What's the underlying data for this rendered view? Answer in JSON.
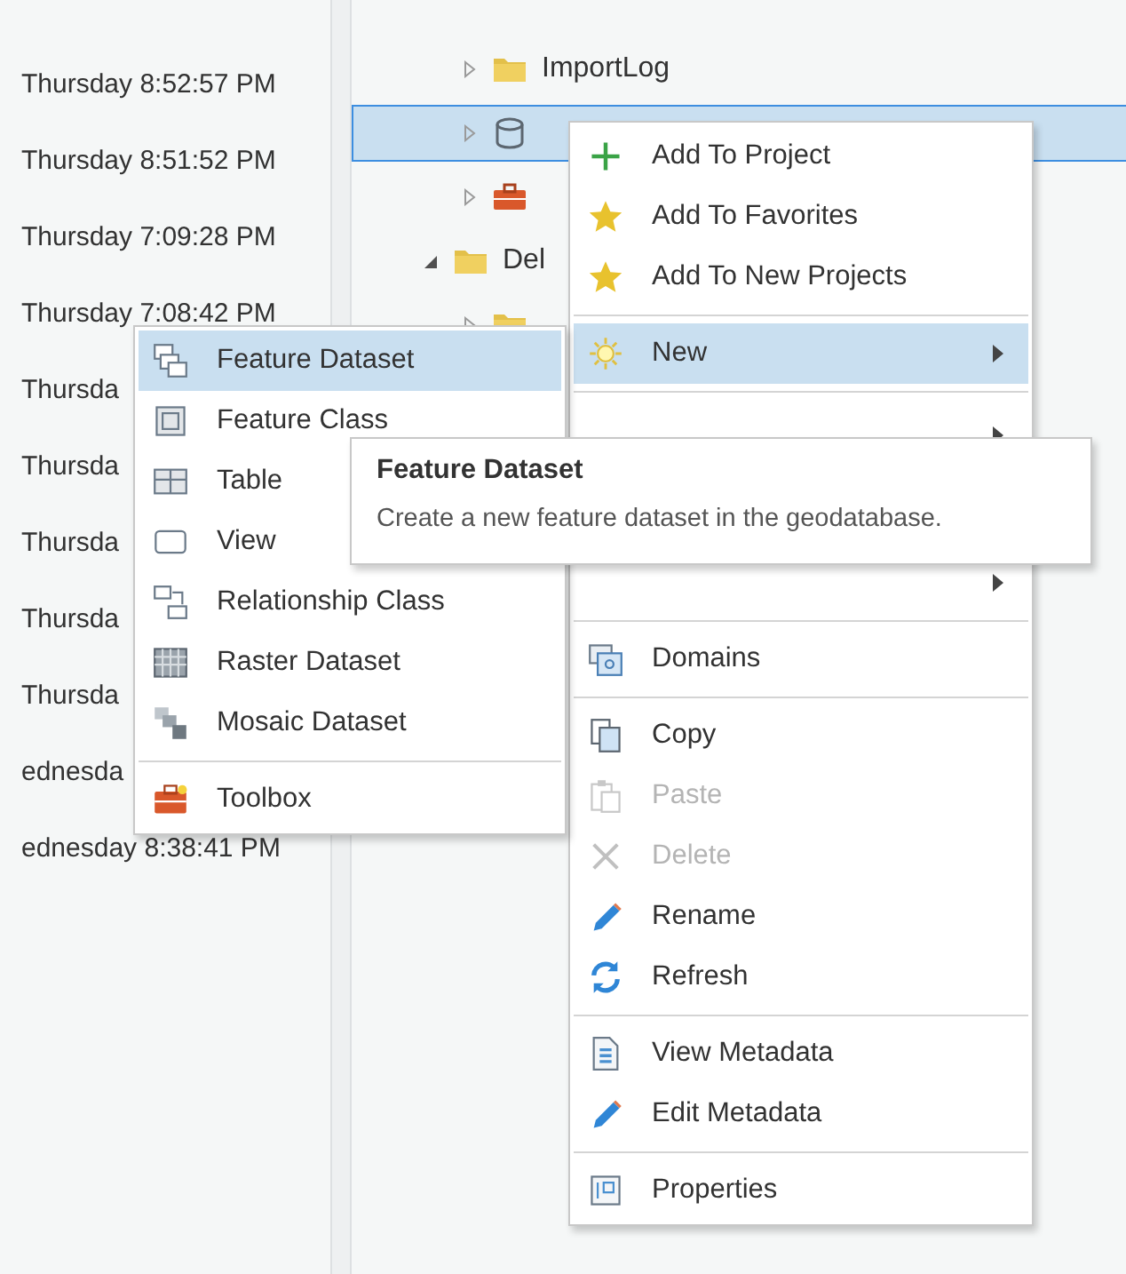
{
  "dates": [
    {
      "text": "Thursday 8:52:57 PM"
    },
    {
      "text": "Thursday 8:51:52 PM"
    },
    {
      "text": "Thursday 7:09:28 PM"
    },
    {
      "text": "Thursday 7:08:42 PM"
    },
    {
      "text": "Thursda"
    },
    {
      "text": "Thursda"
    },
    {
      "text": "Thursda"
    },
    {
      "text": "Thursda"
    },
    {
      "text": "Thursda"
    },
    {
      "text": "ednesda"
    },
    {
      "text": "ednesday 8:38:41 PM"
    }
  ],
  "tree": {
    "items": [
      {
        "kind": "folder",
        "label": "ImportLog",
        "expanded": false,
        "selected": false
      },
      {
        "kind": "database",
        "expanded": false,
        "selected": true
      },
      {
        "kind": "toolbox",
        "expanded": false,
        "selected": false
      },
      {
        "kind": "folder",
        "label": "Del",
        "expanded": true,
        "selected": false,
        "children": [
          {
            "kind": "folder",
            "expanded": false,
            "selected": false
          }
        ]
      }
    ]
  },
  "context_menu": {
    "items": [
      {
        "kind": "item",
        "label": "Add To Project",
        "selected": false,
        "disabled": false,
        "submenu": false
      },
      {
        "kind": "item",
        "label": "Add To Favorites",
        "selected": false,
        "disabled": false,
        "submenu": false
      },
      {
        "kind": "item",
        "label": "Add To New Projects",
        "selected": false,
        "disabled": false,
        "submenu": false
      },
      {
        "kind": "separator"
      },
      {
        "kind": "item",
        "label": "New",
        "selected": true,
        "disabled": false,
        "submenu": true
      },
      {
        "kind": "separator"
      },
      {
        "kind": "item",
        "submenu": true
      },
      {
        "kind": "item",
        "submenu": true
      },
      {
        "kind": "separator"
      },
      {
        "kind": "item",
        "label": "Domains",
        "selected": false,
        "disabled": false,
        "submenu": false
      },
      {
        "kind": "separator"
      },
      {
        "kind": "item",
        "label": "Copy",
        "selected": false,
        "disabled": false,
        "submenu": false
      },
      {
        "kind": "item",
        "label": "Paste",
        "selected": false,
        "disabled": true,
        "submenu": false
      },
      {
        "kind": "item",
        "label": "Delete",
        "selected": false,
        "disabled": true,
        "submenu": false
      },
      {
        "kind": "item",
        "label": "Rename",
        "selected": false,
        "disabled": false,
        "submenu": false
      },
      {
        "kind": "item",
        "label": "Refresh",
        "selected": false,
        "disabled": false,
        "submenu": false
      },
      {
        "kind": "separator"
      },
      {
        "kind": "item",
        "label": "View Metadata",
        "selected": false,
        "disabled": false,
        "submenu": false
      },
      {
        "kind": "item",
        "label": "Edit Metadata",
        "selected": false,
        "disabled": false,
        "submenu": false
      },
      {
        "kind": "separator"
      },
      {
        "kind": "item",
        "label": "Properties",
        "selected": false,
        "disabled": false,
        "submenu": false
      }
    ]
  },
  "new_submenu": {
    "items": [
      {
        "kind": "item",
        "label": "Feature Dataset",
        "selected": true,
        "disabled": false,
        "submenu": false
      },
      {
        "kind": "item",
        "label": "Feature Class",
        "selected": false,
        "disabled": false,
        "submenu": false
      },
      {
        "kind": "item",
        "label": "Table",
        "selected": false,
        "disabled": false,
        "submenu": false
      },
      {
        "kind": "item",
        "label": "View",
        "selected": false,
        "disabled": false,
        "submenu": false
      },
      {
        "kind": "item",
        "label": "Relationship Class",
        "selected": false,
        "disabled": false,
        "submenu": false
      },
      {
        "kind": "item",
        "label": "Raster Dataset",
        "selected": false,
        "disabled": false,
        "submenu": false
      },
      {
        "kind": "item",
        "label": "Mosaic Dataset",
        "selected": false,
        "disabled": false,
        "submenu": false
      },
      {
        "kind": "separator"
      },
      {
        "kind": "item",
        "label": "Toolbox",
        "selected": false,
        "disabled": false,
        "submenu": false
      }
    ]
  },
  "tooltip": {
    "title": "Feature Dataset",
    "description": "Create a new feature dataset in the geodatabase."
  }
}
